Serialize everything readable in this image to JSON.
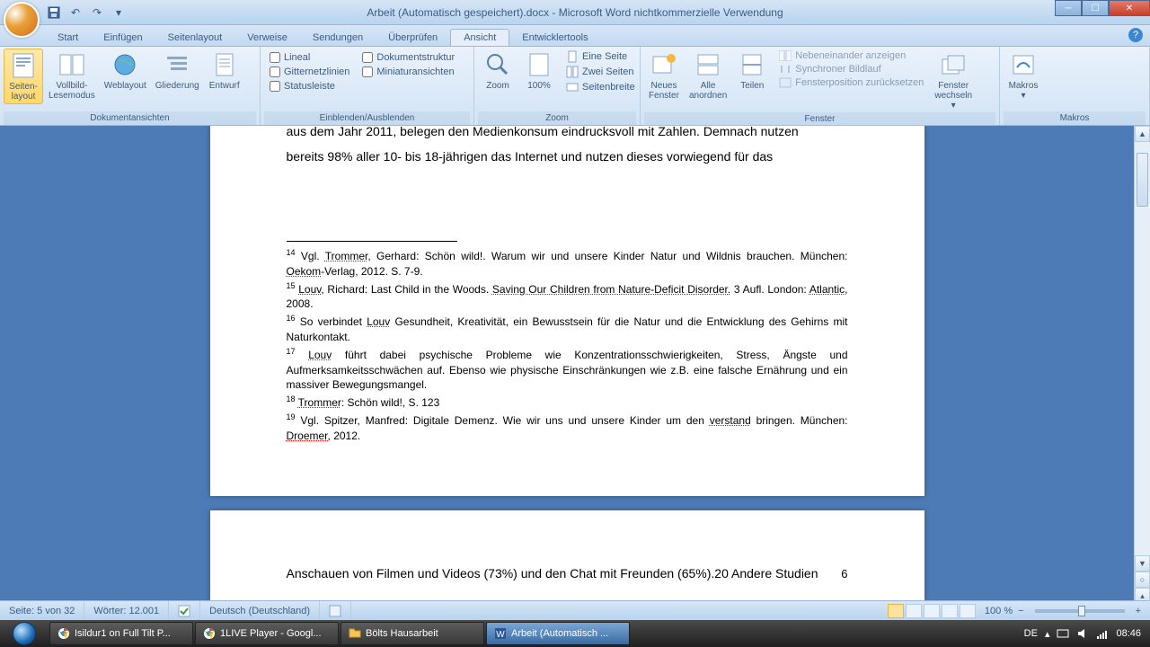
{
  "title": "Arbeit (Automatisch gespeichert).docx - Microsoft Word nichtkommerzielle Verwendung",
  "tabs": [
    "Start",
    "Einfügen",
    "Seitenlayout",
    "Verweise",
    "Sendungen",
    "Überprüfen",
    "Ansicht",
    "Entwicklertools"
  ],
  "activeTab": 6,
  "groups": {
    "views": {
      "label": "Dokumentansichten",
      "items": [
        "Seiten-\nlayout",
        "Vollbild-\nLesemodus",
        "Weblayout",
        "Gliederung",
        "Entwurf"
      ]
    },
    "show": {
      "label": "Einblenden/Ausblenden",
      "col1": [
        "Lineal",
        "Gitternetzlinien",
        "Statusleiste"
      ],
      "col2": [
        "Dokumentstruktur",
        "Miniaturansichten"
      ]
    },
    "zoom": {
      "label": "Zoom",
      "zoom": "Zoom",
      "pct": "100%",
      "opts": [
        "Eine Seite",
        "Zwei Seiten",
        "Seitenbreite"
      ]
    },
    "window": {
      "label": "Fenster",
      "new": "Neues\nFenster",
      "arrange": "Alle\nanordnen",
      "split": "Teilen",
      "side": [
        "Nebeneinander anzeigen",
        "Synchroner Bildlauf",
        "Fensterposition zurücksetzen"
      ],
      "switch": "Fenster\nwechseln"
    },
    "macros": {
      "label": "Makros",
      "btn": "Makros"
    }
  },
  "doc": {
    "line1": "aus dem Jahr 2011, belegen den Medienkonsum eindrucksvoll mit Zahlen. Demnach nutzen",
    "line2": "bereits 98% aller 10- bis 18-jährigen das Internet und nutzen dieses vorwiegend für das",
    "fn14a": "Vgl. ",
    "fn14u": "Trommer",
    "fn14b": ", Gerhard: Schön wild!. Warum wir und unsere Kinder Natur und Wildnis brauchen. München: ",
    "fn14c": "Oekom",
    "fn14d": "-Verlag, 2012. S. 7-9.",
    "fn15a": "Louv",
    "fn15b": ", Richard: Last Child in the Woods. ",
    "fn15c": "Saving Our Children from Nature-Deficit Disorder.",
    "fn15d": " 3 Aufl. London: ",
    "fn15e": "Atlantic,",
    "fn15f": " 2008.",
    "fn16a": "So verbindet ",
    "fn16b": "Louv",
    "fn16c": "  Gesundheit, Kreativität, ein Bewusstsein für die Natur und die Entwicklung des Gehirns mit Naturkontakt.",
    "fn17a": "Louv",
    "fn17b": " führt dabei psychische Probleme wie Konzentrationsschwierigkeiten, Stress, Ängste und Aufmerksamkeitsschwächen auf. Ebenso wie physische Einschränkungen wie z.B.  eine falsche Ernährung und ein massiver Bewegungsmangel.",
    "fn18a": "Trommer",
    "fn18b": ": Schön wild!, S. 123",
    "fn19a": "Vgl. Spitzer, Manfred: Digitale Demenz. Wie wir uns und unsere Kinder um den ",
    "fn19b": "verstand",
    "fn19c": " bringen. München: ",
    "fn19d": "Droemer,",
    "fn19e": " 2012.",
    "pagenum": "6",
    "nextline": "Anschauen von Filmen und Videos (73%) und den Chat mit Freunden (65%).20 Andere Studien"
  },
  "status": {
    "page": "Seite: 5 von 32",
    "words": "Wörter: 12.001",
    "lang": "Deutsch (Deutschland)",
    "zoom": "100 %"
  },
  "taskbar": {
    "items": [
      {
        "label": "Isildur1 on Full Tilt P...",
        "icon": "chrome"
      },
      {
        "label": "1LIVE Player - Googl...",
        "icon": "chrome"
      },
      {
        "label": "Bölts Hausarbeit",
        "icon": "folder"
      },
      {
        "label": "Arbeit (Automatisch ...",
        "icon": "word",
        "active": true
      }
    ],
    "lang": "DE",
    "time": "08:46"
  }
}
